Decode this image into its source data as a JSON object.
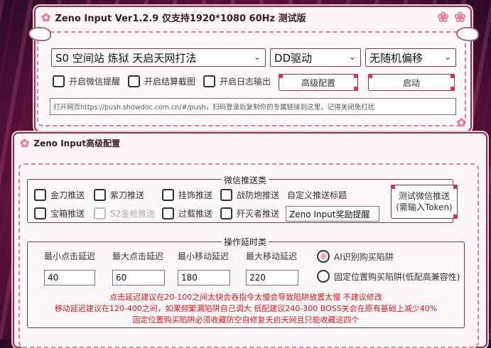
{
  "main_window": {
    "title": "Zeno Input Ver1.2.9 仅支持1920*1080 60Hz 测试版",
    "map_select": "S0 空间站 炼狱 天启天网打法",
    "driver_select": "DD驱动",
    "offset_select": "无随机偏移",
    "checkboxes": [
      {
        "label": "开启微信提醒",
        "checked": false
      },
      {
        "label": "开启结算截图",
        "checked": false
      },
      {
        "label": "开启日志输出",
        "checked": false
      }
    ],
    "advanced_button": "高级配置",
    "start_button": "启动",
    "push_url_placeholder": "打开网页https://push.showdoc.com.cn/#/push，扫码登录后复制你的专属链接到这里，记得关闭免打扰"
  },
  "advanced_window": {
    "title": "Zeno Input高级配置",
    "wechat_group": {
      "title": "微信推送类",
      "checkboxes": [
        {
          "label": "金刀推送",
          "checked": false,
          "disabled": false
        },
        {
          "label": "紫刀推送",
          "checked": false,
          "disabled": false
        },
        {
          "label": "挂饰推送",
          "checked": false,
          "disabled": false
        },
        {
          "label": "战防炮推送",
          "checked": false,
          "disabled": false
        },
        {
          "label": "宝箱推送",
          "checked": false,
          "disabled": false
        },
        {
          "label": "S2金枪推送",
          "checked": false,
          "disabled": true
        },
        {
          "label": "过载推送",
          "checked": false,
          "disabled": false
        },
        {
          "label": "歼灭者推送",
          "checked": false,
          "disabled": false
        }
      ],
      "custom_title_label": "自定义推送标题",
      "custom_title_value": "Zeno Input奖励提醒",
      "test_button_line1": "测试微信推送",
      "test_button_line2": "(需输入Token)"
    },
    "delay_group": {
      "title": "操作延时类",
      "fields": [
        {
          "label": "最小点击延迟",
          "value": "40"
        },
        {
          "label": "最大点击延迟",
          "value": "60"
        },
        {
          "label": "最小移动延迟",
          "value": "180"
        },
        {
          "label": "最大移动延迟",
          "value": "220"
        }
      ],
      "radios": [
        {
          "label": "AI识别购买陷阱",
          "selected": true
        },
        {
          "label": "固定位置购买陷阱(低配高兼容性)",
          "selected": false
        }
      ],
      "notes": [
        "点击延迟建议在20-100之间太快会吞指令太慢会导致陷阱放置太慢 不建议修改",
        "移动延迟建议在120-400之间，如果频繁漏陷阱自己调大 低配建议240-300 BOSS关会在原有基础上减少40%",
        "固定位置购买陷阱必须收藏防空自修复天启天网且只能收藏这四个"
      ]
    }
  },
  "colors": {
    "accent_pink": "#f07ca0",
    "border": "#7a3b4f",
    "note_red": "#d81b1b",
    "window_bg": "#fff5f8"
  }
}
